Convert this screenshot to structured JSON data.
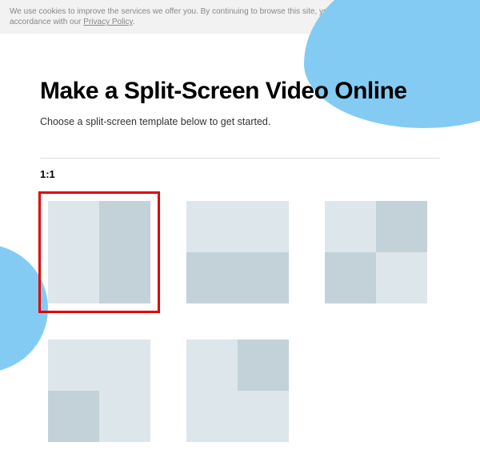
{
  "cookie": {
    "text_before": "We use cookies to improve the services we offer you. By continuing to browse this site, you consent to keep them in accordance with our ",
    "link_label": "Privacy Policy",
    "text_after": "."
  },
  "page": {
    "title": "Make a Split-Screen Video Online",
    "subtitle": "Choose a split-screen template below to get started."
  },
  "section": {
    "ratio_label": "1:1"
  },
  "templates": [
    {
      "id": "split-vertical",
      "selected": true
    },
    {
      "id": "split-horizontal",
      "selected": false
    },
    {
      "id": "quad",
      "selected": false
    },
    {
      "id": "one-over-two",
      "selected": false
    },
    {
      "id": "two-over-one",
      "selected": false
    }
  ],
  "colors": {
    "accent_blob": "#84cbf4",
    "cell_light": "#dde6ea",
    "cell_dark": "#c3d2d9",
    "selection": "#e30000"
  }
}
